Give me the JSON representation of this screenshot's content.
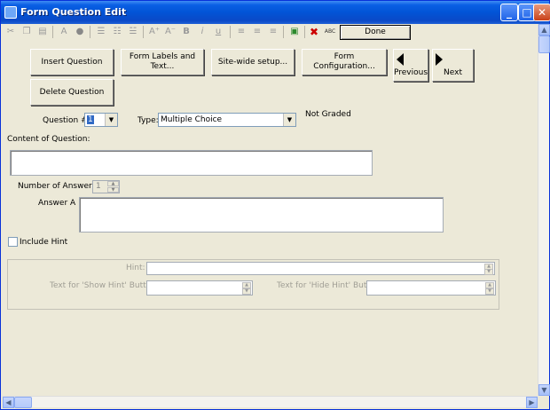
{
  "window": {
    "title": "Form Question Edit"
  },
  "toolbar": {
    "done_label": "Done",
    "icons": [
      "cut-icon",
      "copy-icon",
      "paste-icon",
      "font-icon",
      "color-icon",
      "bullets-icon",
      "numbering-icon",
      "indent-icon",
      "superscript-icon",
      "subscript-icon",
      "bold-icon",
      "italic-icon",
      "underline-icon",
      "align-left-icon",
      "align-center-icon",
      "align-right-icon",
      "image-icon",
      "delete-icon",
      "spellcheck-icon"
    ],
    "glyphs": {
      "font": "A",
      "superscript": "A⁺",
      "subscript": "A⁻",
      "bold": "B",
      "italic": "i",
      "underline": "u",
      "delete": "✖",
      "spellcheck": "ABC"
    }
  },
  "buttons": {
    "insert_question": "Insert Question",
    "form_labels_line1": "Form Labels and",
    "form_labels_line2": "Text...",
    "site_wide_setup": "Site-wide setup...",
    "form_configuration": "Form Configuration...",
    "previous": "Previous",
    "next": "Next",
    "delete_question": "Delete Question"
  },
  "question": {
    "number_label": "Question #",
    "number_value": "1",
    "type_label": "Type:",
    "type_value": "Multiple Choice",
    "graded_status": "Not Graded",
    "content_label": "Content of Question:",
    "content_value": "",
    "num_answers_label": "Number of Answers",
    "num_answers_value": "1",
    "answer_label": "Answer A",
    "answer_value": ""
  },
  "hint": {
    "include_label": "Include Hint",
    "include_checked": false,
    "hint_label": "Hint:",
    "show_hint_label": "Text for 'Show Hint' Button:",
    "hide_hint_label": "Text for 'Hide Hint' Button:"
  },
  "colors": {
    "titlebar": "#0a5fe4",
    "background": "#ece9d8",
    "close_button": "#c9421a",
    "delete_icon": "#cc0000",
    "selection": "#316ac5"
  }
}
